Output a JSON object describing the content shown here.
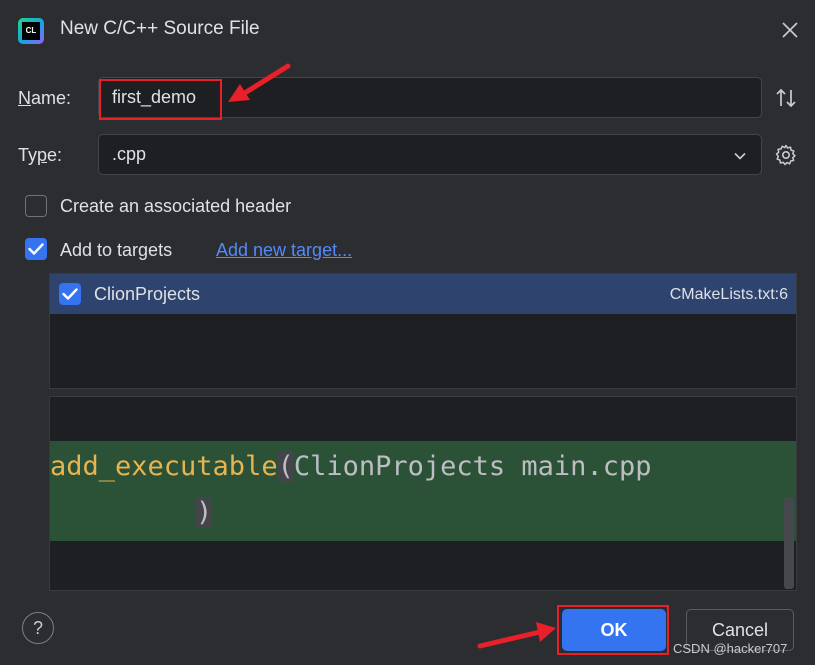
{
  "dialog": {
    "title": "New C/C++ Source File",
    "app_icon_text": "CL"
  },
  "name_field": {
    "label_prefix": "N",
    "label_rest": "ame:",
    "value": "first_demo"
  },
  "type_field": {
    "label_prefix": "Ty",
    "label_underline": "p",
    "label_rest": "e:",
    "value": ".cpp"
  },
  "options": {
    "associated_header": {
      "label": "Create an associated header",
      "checked": false
    },
    "add_to_targets": {
      "label": "Add to targets",
      "checked": true
    },
    "add_new_target_link": "Add new target..."
  },
  "targets": [
    {
      "name": "ClionProjects",
      "file": "CMakeLists.txt:6",
      "checked": true
    }
  ],
  "preview": {
    "line1_fn": "add_executable",
    "line1_open": "(",
    "line1_args": "ClionProjects main.cpp",
    "line2_close": ")"
  },
  "buttons": {
    "help": "?",
    "ok": "OK",
    "cancel": "Cancel"
  },
  "watermark": "CSDN @hacker707",
  "colors": {
    "accent": "#3574f0",
    "highlight": "#e8202a",
    "code_band": "#2b5237",
    "selection": "#2e436e"
  }
}
